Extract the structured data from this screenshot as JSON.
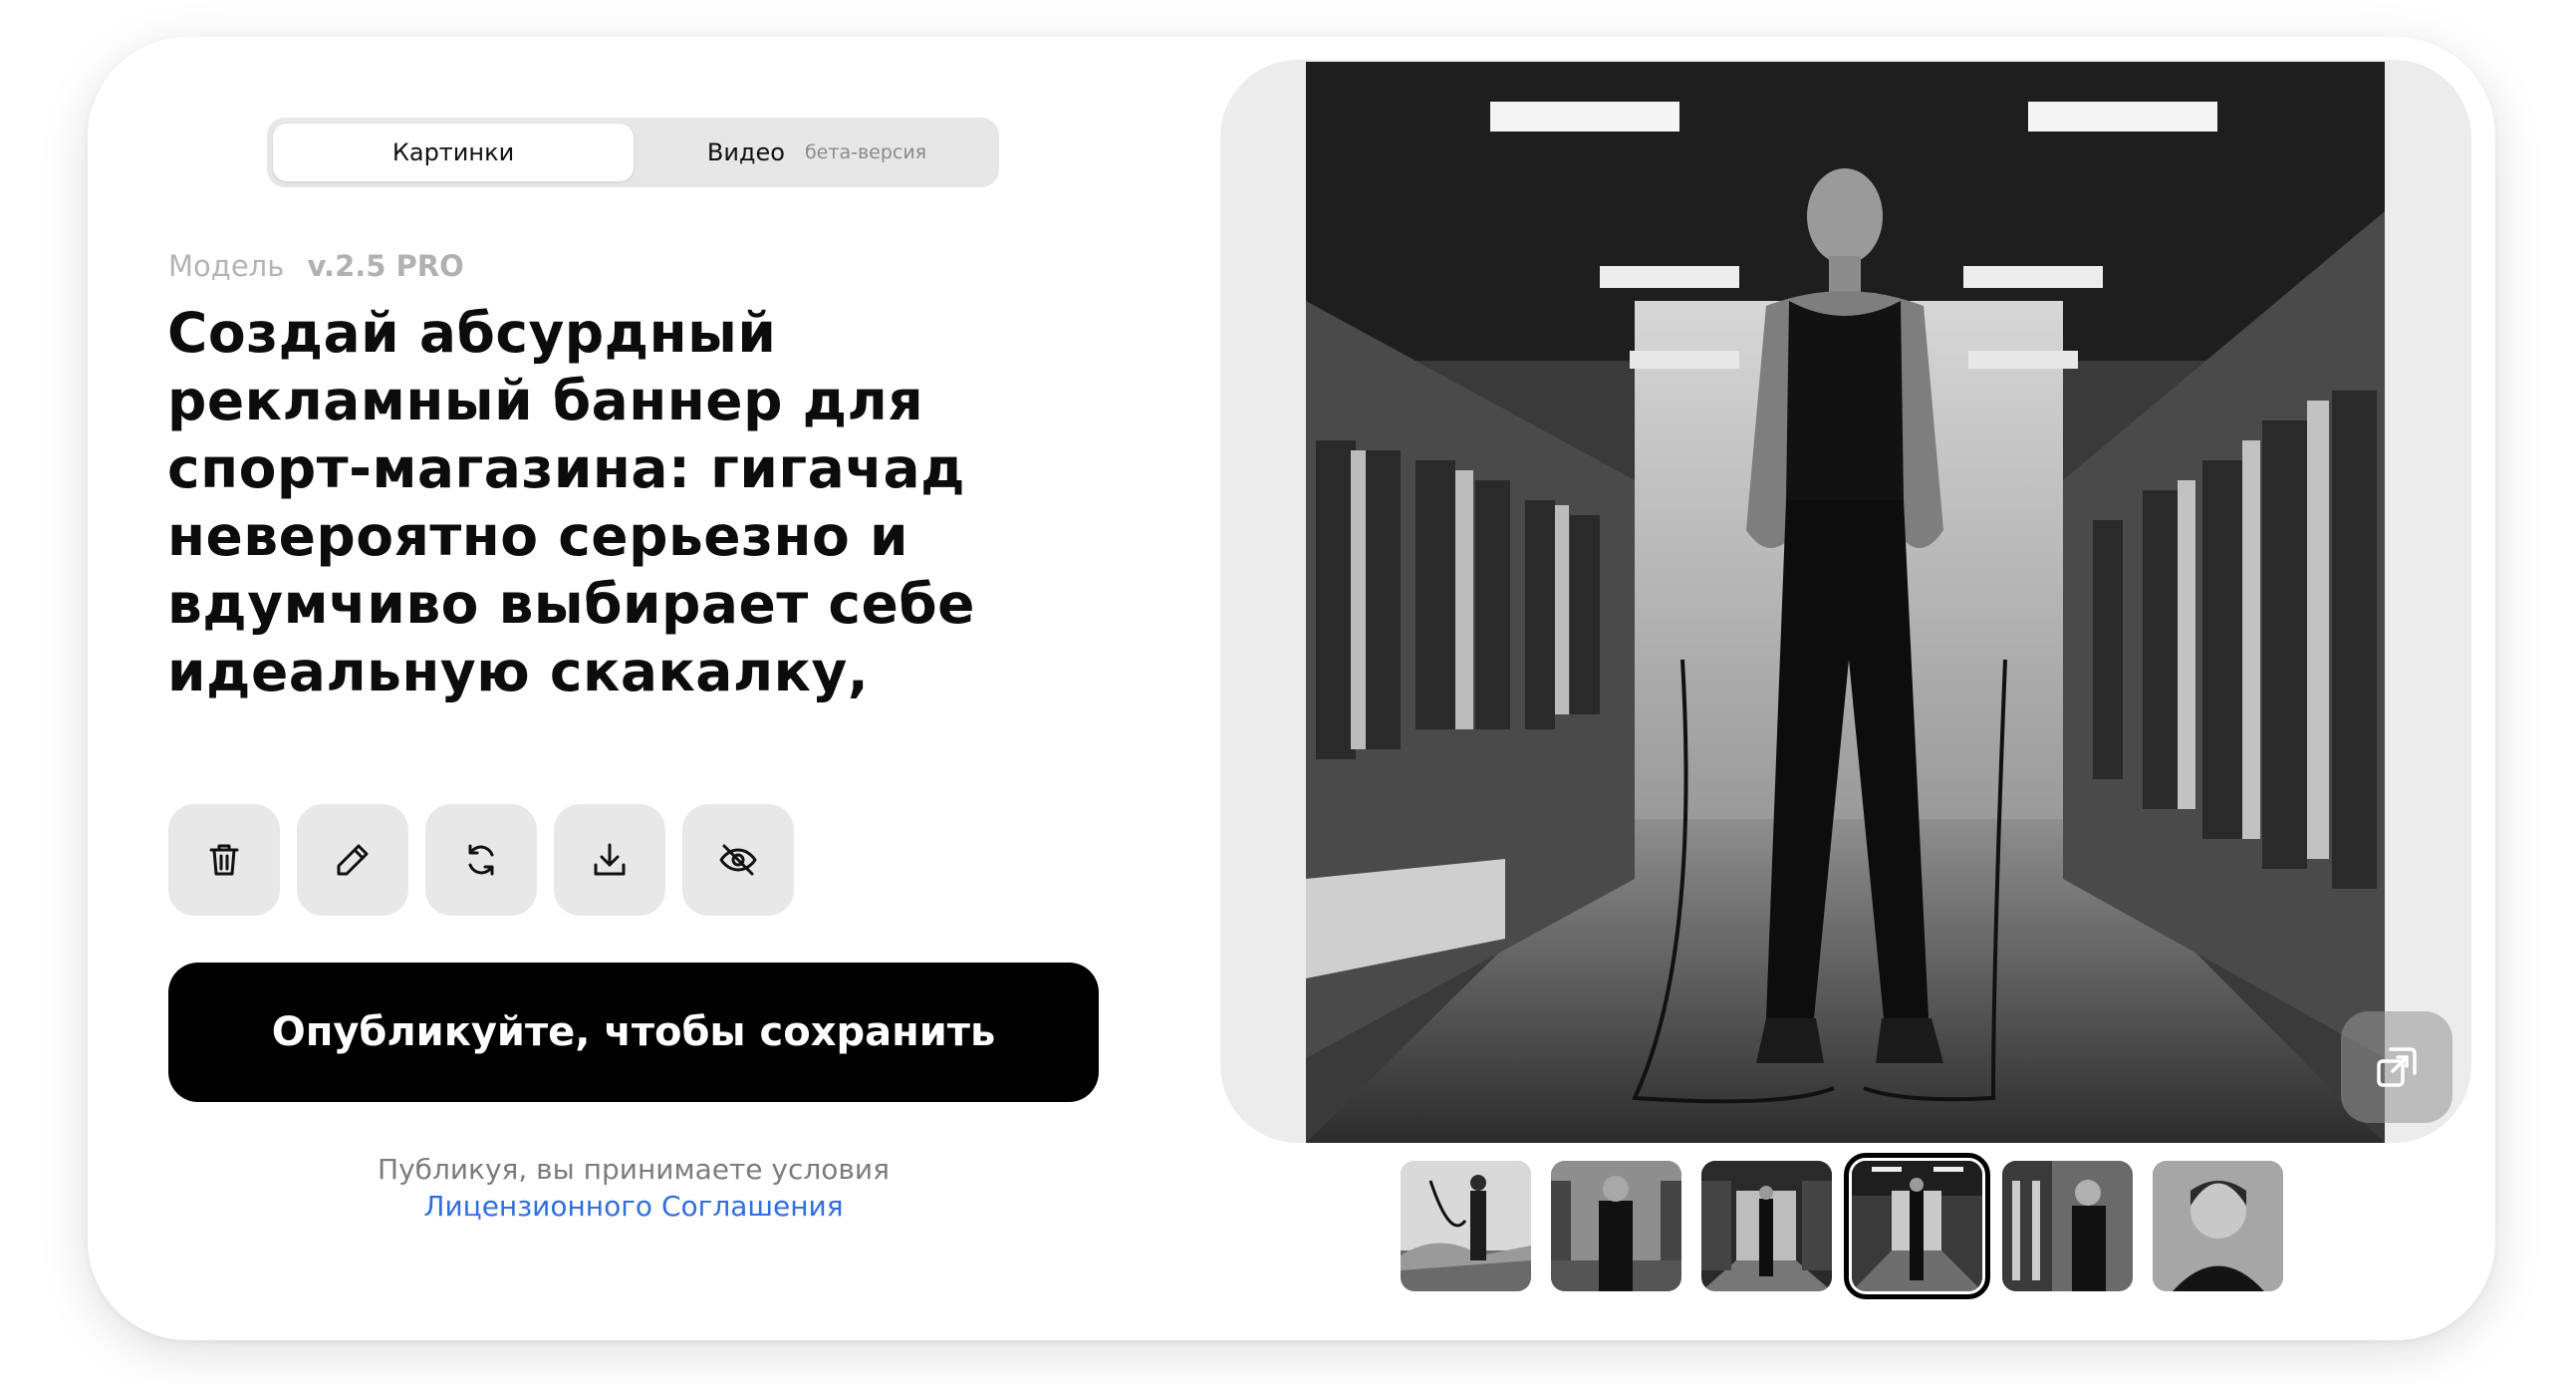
{
  "tabs": {
    "images_label": "Картинки",
    "video_label": "Видео",
    "video_badge": "бета-версия"
  },
  "model": {
    "label": "Модель",
    "version": "v.2.5 PRO"
  },
  "prompt": {
    "text": "Создай абсурдный рекламный баннер для спорт-магазина: гигачад невероятно серьезно и вдумчиво выбирает себе идеальную скакалку,"
  },
  "actions": [
    {
      "icon": "trash-icon"
    },
    {
      "icon": "pencil-icon"
    },
    {
      "icon": "refresh-icon"
    },
    {
      "icon": "download-icon"
    },
    {
      "icon": "eye-off-icon"
    }
  ],
  "publish": {
    "button_label": "Опубликуйте, чтобы сохранить"
  },
  "terms": {
    "text": "Публикуя, вы принимаете условия",
    "link": "Лицензионного Соглашения"
  },
  "colors": {
    "accent": "#000000",
    "link": "#2f6fe0",
    "panel": "#ececec"
  },
  "preview": {
    "icon": "expand-icon"
  },
  "thumbnails": {
    "count": 6,
    "selected_index": 3
  }
}
